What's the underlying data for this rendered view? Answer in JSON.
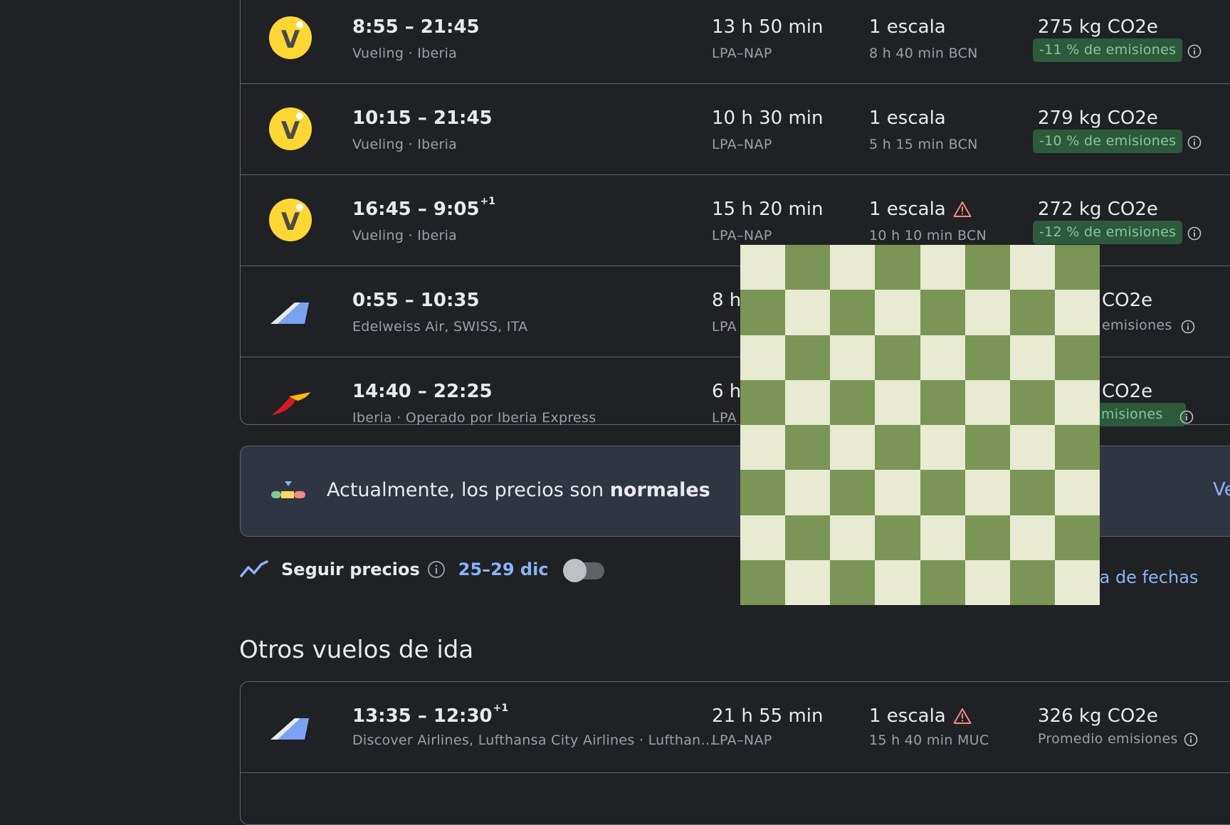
{
  "flights": [
    {
      "times": "8:55 – 21:45",
      "next_day": "",
      "airline": "Vueling · Iberia",
      "duration": "13 h 50 min",
      "route": "LPA–NAP",
      "stops": "1 escala",
      "warning": false,
      "stop_detail": "8 h 40 min BCN",
      "co2": "275 kg CO2e",
      "emissions": "-11 % de emisiones",
      "logo": "vueling-logo"
    },
    {
      "times": "10:15 – 21:45",
      "next_day": "",
      "airline": "Vueling · Iberia",
      "duration": "10 h 30 min",
      "route": "LPA–NAP",
      "stops": "1 escala",
      "warning": false,
      "stop_detail": "5 h 15 min BCN",
      "co2": "279 kg CO2e",
      "emissions": "-10 % de emisiones",
      "logo": "vueling-logo"
    },
    {
      "times": "16:45 – 9:05",
      "next_day": "+1",
      "airline": "Vueling · Iberia",
      "duration": "15 h 20 min",
      "route": "LPA–NAP",
      "stops": "1 escala",
      "warning": true,
      "stop_detail": "10 h 10 min BCN",
      "co2": "272 kg CO2e",
      "emissions": "-12 % de emisiones",
      "logo": "vueling-logo"
    },
    {
      "times": "0:55 – 10:35",
      "next_day": "",
      "airline": "Edelweiss Air, SWISS, ITA",
      "duration": "8 h",
      "route": "LPA",
      "stops": "",
      "warning": false,
      "stop_detail": "",
      "co2": "CO2e",
      "emissions": "emisiones",
      "logo": "multi-airline-logo"
    },
    {
      "times": "14:40 – 22:25",
      "next_day": "",
      "airline": "Iberia · Operado por Iberia Express",
      "duration": "6 h",
      "route": "LPA",
      "stops": "",
      "warning": false,
      "stop_detail": "",
      "co2": "CO2e",
      "emissions": "misiones",
      "logo": "iberia-logo"
    }
  ],
  "price_banner": {
    "text_prefix": "Actualmente, los precios son ",
    "text_bold": "normales",
    "link": "Ve"
  },
  "tracking": {
    "label": "Seguir precios",
    "dates": "25–29 dic",
    "date_grid_link": "abla de fechas"
  },
  "other_section": {
    "title": "Otros vuelos de ida",
    "flight": {
      "times": "13:35 – 12:30",
      "next_day": "+1",
      "airline": "Discover Airlines, Lufthansa City Airlines · Lufthan…",
      "duration": "21 h 55 min",
      "route": "LPA–NAP",
      "stops": "1 escala",
      "stop_detail": "15 h 40 min MUC",
      "co2": "326 kg CO2e",
      "emissions": "Promedio emisiones"
    }
  },
  "colors": {
    "accent": "#8ab4f8",
    "badge_bg": "#2d5a3d",
    "badge_text": "#81c995",
    "checker_dark": "#7a9556",
    "checker_light": "#e8ead2",
    "warning": "#f28b82",
    "vueling": "#fdd835"
  }
}
